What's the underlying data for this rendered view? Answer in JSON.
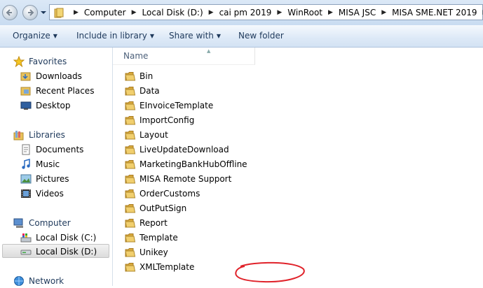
{
  "address": {
    "crumbs": [
      "Computer",
      "Local Disk (D:)",
      "cai pm 2019",
      "WinRoot",
      "MISA JSC",
      "MISA SME.NET 2019"
    ]
  },
  "toolbar": {
    "organize": "Organize",
    "include": "Include in library",
    "share": "Share with",
    "newfolder": "New folder"
  },
  "nav": {
    "favorites": "Favorites",
    "downloads": "Downloads",
    "recent": "Recent Places",
    "desktop": "Desktop",
    "libraries": "Libraries",
    "documents": "Documents",
    "music": "Music",
    "pictures": "Pictures",
    "videos": "Videos",
    "computer": "Computer",
    "disk_c": "Local Disk (C:)",
    "disk_d": "Local Disk (D:)",
    "network": "Network"
  },
  "content": {
    "column_name": "Name",
    "items": [
      "Bin",
      "Data",
      "EInvoiceTemplate",
      "ImportConfig",
      "Layout",
      "LiveUpdateDownload",
      "MarketingBankHubOffline",
      "MISA Remote Support",
      "OrderCustoms",
      "OutPutSign",
      "Report",
      "Template",
      "Unikey",
      "XMLTemplate"
    ],
    "highlighted": "Report"
  },
  "colors": {
    "annotation": "#e0222a",
    "folder": "#e8c15a",
    "selection": "#dcdcdc"
  }
}
